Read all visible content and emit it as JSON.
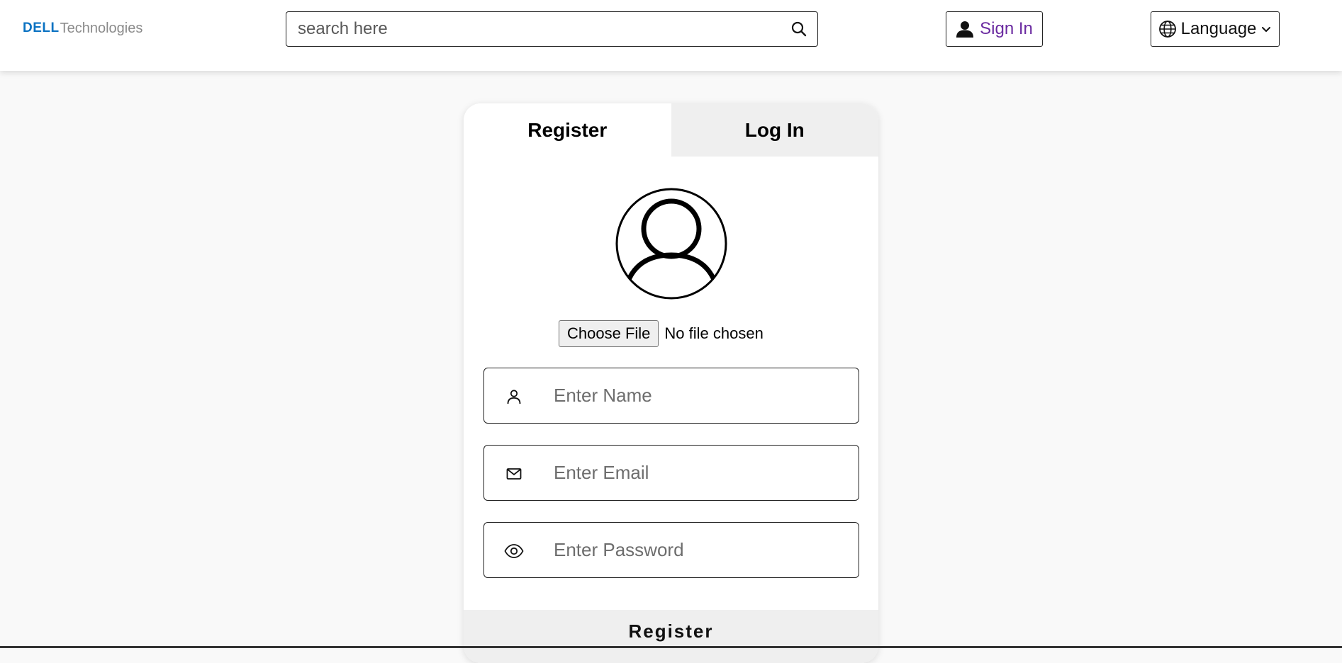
{
  "header": {
    "logo": {
      "brand": "DELL",
      "sub": "Technologies"
    },
    "search": {
      "placeholder": "search here"
    },
    "sign_in_label": "Sign In",
    "language_label": "Language"
  },
  "card": {
    "tabs": [
      {
        "label": "Register",
        "active": true
      },
      {
        "label": "Log In",
        "active": false
      }
    ],
    "file": {
      "button_label": "Choose File",
      "status": "No file chosen"
    },
    "fields": [
      {
        "icon": "user-icon",
        "placeholder": "Enter Name"
      },
      {
        "icon": "mail-icon",
        "placeholder": "Enter Email"
      },
      {
        "icon": "eye-icon",
        "placeholder": "Enter Password"
      }
    ],
    "submit_label": "Register"
  },
  "colors": {
    "brand_blue": "#0a72c2",
    "sign_in_purple": "#6a2aa0",
    "page_bg": "#f9f9f9",
    "tab_inactive_bg": "#efefef"
  }
}
